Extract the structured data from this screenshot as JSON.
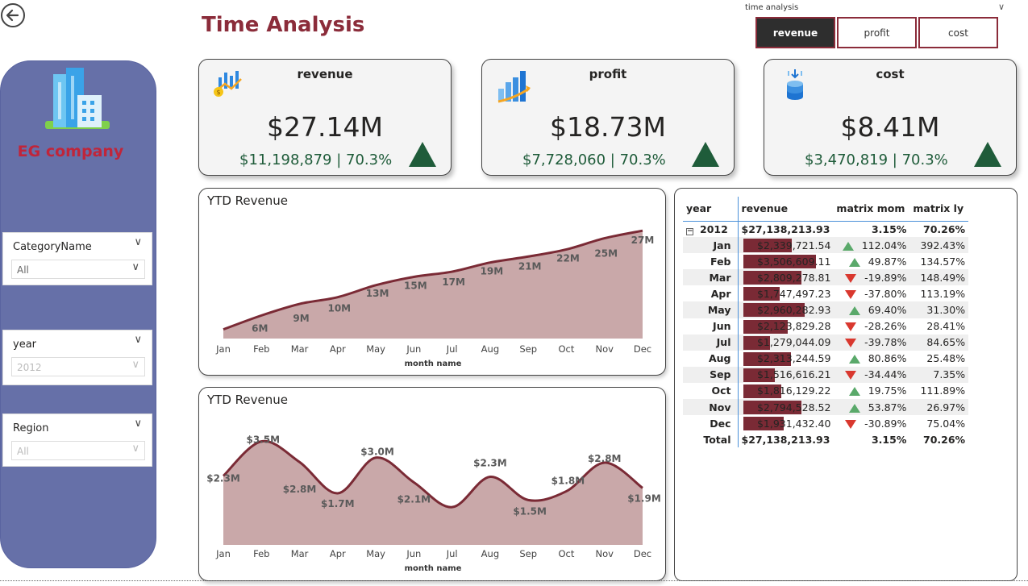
{
  "header": {
    "title": "Time Analysis",
    "back_label": "back"
  },
  "time_analysis": {
    "label": "time analysis",
    "options": [
      "revenue",
      "profit",
      "cost"
    ],
    "selected": "revenue"
  },
  "sidebar": {
    "company": "EG company",
    "slicers": [
      {
        "label": "CategoryName",
        "value": "All",
        "disabled": false
      },
      {
        "label": "year",
        "value": "2012",
        "disabled": true
      },
      {
        "label": "Region",
        "value": "All",
        "disabled": true
      }
    ]
  },
  "cards": [
    {
      "title": "revenue",
      "value": "$27.14M",
      "sub": "$11,198,879 | 70.3%",
      "icon": "growth-coin-icon"
    },
    {
      "title": "profit",
      "value": "$18.73M",
      "sub": "$7,728,060 | 70.3%",
      "icon": "bar-growth-icon"
    },
    {
      "title": "cost",
      "value": "$8.41M",
      "sub": "$3,470,819 | 70.3%",
      "icon": "coin-stack-icon"
    }
  ],
  "colors": {
    "accent": "#8b2c3a",
    "fill": "#c9a8a9",
    "line": "#7a2a35",
    "up": "#5aa96a",
    "down": "#d9382f",
    "card_green": "#1f5c3a",
    "sidebar": "#6670a8"
  },
  "chart_data": [
    {
      "type": "area",
      "title": "YTD Revenue",
      "xlabel": "month name",
      "categories": [
        "Jan",
        "Feb",
        "Mar",
        "Apr",
        "May",
        "Jun",
        "Jul",
        "Aug",
        "Sep",
        "Oct",
        "Nov",
        "Dec"
      ],
      "values": [
        2.3,
        5.8,
        8.7,
        10.4,
        13.4,
        15.5,
        16.8,
        19.1,
        20.6,
        22.4,
        25.2,
        27.1
      ],
      "labels": [
        "",
        "6M",
        "9M",
        "10M",
        "13M",
        "15M",
        "17M",
        "19M",
        "21M",
        "22M",
        "25M",
        "27M"
      ],
      "ylim": [
        0,
        27.14
      ]
    },
    {
      "type": "area",
      "title": "YTD Revenue",
      "xlabel": "month name",
      "categories": [
        "Jan",
        "Feb",
        "Mar",
        "Apr",
        "May",
        "Jun",
        "Jul",
        "Aug",
        "Sep",
        "Oct",
        "Nov",
        "Dec"
      ],
      "values": [
        2.34,
        3.51,
        2.81,
        1.75,
        2.96,
        2.12,
        1.28,
        2.31,
        1.52,
        1.82,
        2.79,
        1.93
      ],
      "labels": [
        "$2.3M",
        "$3.5M",
        "$2.8M",
        "$1.7M",
        "$3.0M",
        "$2.1M",
        "",
        "$2.3M",
        "$1.5M",
        "$1.8M",
        "$2.8M",
        "$1.9M"
      ],
      "ylim": [
        0,
        3.8
      ]
    }
  ],
  "matrix": {
    "headers": [
      "year",
      "revenue",
      "matrix mom",
      "matrix ly"
    ],
    "year_row": {
      "label": "2012",
      "revenue": "$27,138,213.93",
      "mom": "3.15%",
      "ly": "70.26%"
    },
    "rows": [
      {
        "month": "Jan",
        "revenue": "$2,339,721.54",
        "rev": 2339721.54,
        "dir": "up",
        "mom": "112.04%",
        "ly": "392.43%"
      },
      {
        "month": "Feb",
        "revenue": "$3,506,609.11",
        "rev": 3506609.11,
        "dir": "up",
        "mom": "49.87%",
        "ly": "134.57%"
      },
      {
        "month": "Mar",
        "revenue": "$2,809,278.81",
        "rev": 2809278.81,
        "dir": "down",
        "mom": "-19.89%",
        "ly": "148.49%"
      },
      {
        "month": "Apr",
        "revenue": "$1,747,497.23",
        "rev": 1747497.23,
        "dir": "down",
        "mom": "-37.80%",
        "ly": "113.19%"
      },
      {
        "month": "May",
        "revenue": "$2,960,282.93",
        "rev": 2960282.93,
        "dir": "up",
        "mom": "69.40%",
        "ly": "31.30%"
      },
      {
        "month": "Jun",
        "revenue": "$2,123,829.28",
        "rev": 2123829.28,
        "dir": "down",
        "mom": "-28.26%",
        "ly": "28.41%"
      },
      {
        "month": "Jul",
        "revenue": "$1,279,044.09",
        "rev": 1279044.09,
        "dir": "down",
        "mom": "-39.78%",
        "ly": "84.65%"
      },
      {
        "month": "Aug",
        "revenue": "$2,313,244.59",
        "rev": 2313244.59,
        "dir": "up",
        "mom": "80.86%",
        "ly": "25.48%"
      },
      {
        "month": "Sep",
        "revenue": "$1,516,616.21",
        "rev": 1516616.21,
        "dir": "down",
        "mom": "-34.44%",
        "ly": "7.35%"
      },
      {
        "month": "Oct",
        "revenue": "$1,816,129.22",
        "rev": 1816129.22,
        "dir": "up",
        "mom": "19.75%",
        "ly": "111.89%"
      },
      {
        "month": "Nov",
        "revenue": "$2,794,528.52",
        "rev": 2794528.52,
        "dir": "up",
        "mom": "53.87%",
        "ly": "26.97%"
      },
      {
        "month": "Dec",
        "revenue": "$1,931,432.40",
        "rev": 1931432.4,
        "dir": "down",
        "mom": "-30.89%",
        "ly": "75.04%"
      }
    ],
    "total": {
      "label": "Total",
      "revenue": "$27,138,213.93",
      "mom": "3.15%",
      "ly": "70.26%"
    }
  }
}
